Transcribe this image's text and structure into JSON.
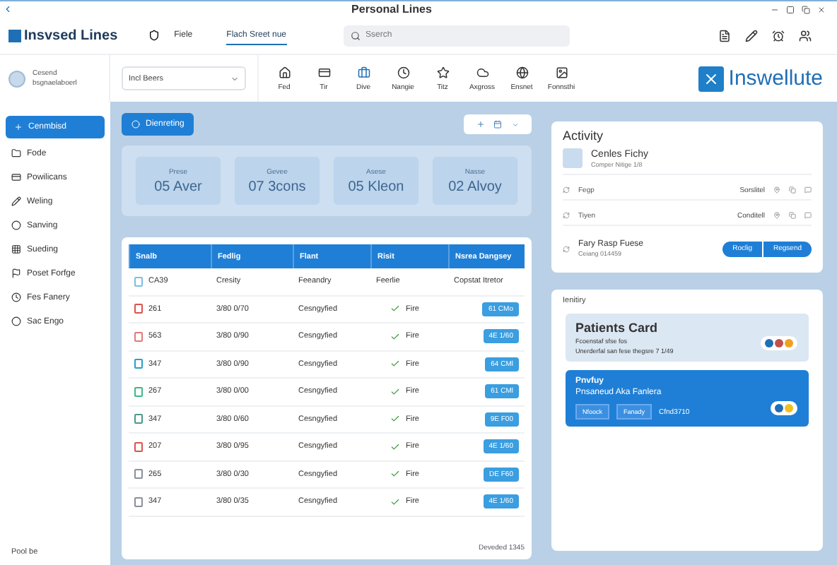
{
  "window": {
    "title": "Personal Lines"
  },
  "header": {
    "app_name": "Insvsed Lines",
    "file_label": "Fiele",
    "tab": "Flach Sreet nue",
    "search": {
      "placeholder": "Sserch"
    }
  },
  "toolbar": {
    "user": {
      "line1": "Cesend",
      "line2": "bsgnaelaboerl"
    },
    "select": "Incl Beers",
    "tools": [
      {
        "label": "Fed",
        "selected": false
      },
      {
        "label": "Tir",
        "selected": false
      },
      {
        "label": "Dive",
        "selected": true
      },
      {
        "label": "Nangie",
        "selected": false
      },
      {
        "label": "Titz",
        "selected": false
      },
      {
        "label": "Axgross",
        "selected": false
      },
      {
        "label": "Ensnet",
        "selected": false
      },
      {
        "label": "Fonnsthi",
        "selected": false
      }
    ],
    "brand": "Inswellute"
  },
  "sidebar": {
    "primary": "Cenmbisd",
    "items": [
      "Fode",
      "Powilicans",
      "Weling",
      "Sanving",
      "Sueding",
      "Poset Forfge",
      "Fes Fanery",
      "Sac Engo"
    ],
    "footer": "Pool be"
  },
  "main": {
    "action": "Dienreting",
    "stats": [
      {
        "label": "Prese",
        "value": "05 Aver"
      },
      {
        "label": "Gevee",
        "value": "07 3cons"
      },
      {
        "label": "Asese",
        "value": "05 Kleon"
      },
      {
        "label": "Nasse",
        "value": "02 Alvoy"
      }
    ],
    "table": {
      "columns": [
        "Snalb",
        "Fedlig",
        "Flant",
        "Risit",
        "Nsrea Dangsey"
      ],
      "first_row": [
        "CA39",
        "Cresity",
        "Feeandry",
        "Feerlie",
        "Copstat Itretor"
      ],
      "rows": [
        {
          "id": "261",
          "date": "3/80 0/70",
          "type": "Cesngyfied",
          "status": "Fire",
          "badge": "61 CMo",
          "color": "#d9534f"
        },
        {
          "id": "563",
          "date": "3/80 0/90",
          "type": "Cesngyfied",
          "status": "Fire",
          "badge": "4E 1/60",
          "color": "#e07a7a"
        },
        {
          "id": "347",
          "date": "3/80 0/90",
          "type": "Cesngyfied",
          "status": "Fire",
          "badge": "64 CMl",
          "color": "#2a9fc9"
        },
        {
          "id": "267",
          "date": "3/80 0/00",
          "type": "Cesngyfied",
          "status": "Fire",
          "badge": "61 CMl",
          "color": "#3cb88a"
        },
        {
          "id": "347",
          "date": "3/80 0/60",
          "type": "Cesngyfied",
          "status": "Fire",
          "badge": "9E F00",
          "color": "#4a9a8a"
        },
        {
          "id": "207",
          "date": "3/80 0/95",
          "type": "Cesngyfied",
          "status": "Fire",
          "badge": "4E 1/60",
          "color": "#d9534f"
        },
        {
          "id": "265",
          "date": "3/80 0/30",
          "type": "Cesngyfied",
          "status": "Fire",
          "badge": "DE F60",
          "color": "#8a8f99"
        },
        {
          "id": "347",
          "date": "3/80 0/35",
          "type": "Cesngyfied",
          "status": "Fire",
          "badge": "4E 1/60",
          "color": "#8a8f99"
        }
      ],
      "footer": "Deveded 1345"
    }
  },
  "activity": {
    "title": "Activity",
    "lead": {
      "name": "Cenles Fichy",
      "sub": "Comper Nitige 1/8"
    },
    "rows": [
      {
        "label": "Fegp",
        "value": "Sorslitel"
      },
      {
        "label": "Tiyen",
        "value": "Conditell"
      }
    ],
    "request": {
      "name": "Fary Rasp Fuese",
      "sub": "Ceiang 014459",
      "buttons": [
        "Roclig",
        "Regsend"
      ]
    }
  },
  "inventory": {
    "title": "Ienitiry",
    "cards": [
      {
        "kind": "light",
        "title": "Patients Card",
        "line1": "Fcoenstaf sfse fos",
        "line2": "Unerderfal san fese thegsre 7 1/49",
        "dots": [
          {
            "color": "#1f6fb5"
          },
          {
            "color": "#c0504d"
          },
          {
            "color": "#f0a020"
          }
        ]
      },
      {
        "kind": "dark",
        "title": "Pnvfuy",
        "line1": "Pnsaneud Aka Fanlera",
        "chips": [
          "Nfoock",
          "Fanady"
        ],
        "note": "Cfnd3710",
        "dots": [
          {
            "color": "#1f6fb5"
          },
          {
            "color": "#f0c020"
          }
        ]
      }
    ]
  }
}
